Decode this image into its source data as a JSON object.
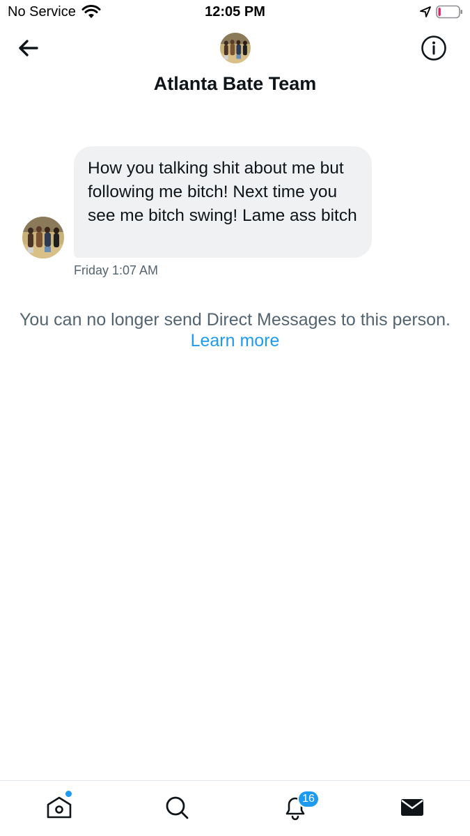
{
  "status_bar": {
    "carrier": "No Service",
    "time": "12:05 PM",
    "battery_level": 0.12
  },
  "header": {
    "title": "Atlanta Bate Team"
  },
  "messages": [
    {
      "text": "How you talking shit about me but following me bitch! Next time you see me bitch swing! Lame ass bitch",
      "timestamp": "Friday 1:07 AM"
    }
  ],
  "notice": {
    "text": "You can no longer send Direct Messages to this person.",
    "link": "Learn more"
  },
  "tab_bar": {
    "notifications_badge": "16",
    "active_tab": "messages"
  },
  "colors": {
    "accent": "#1d9bf0",
    "bubble": "#eff1f3",
    "secondary_text": "#536471",
    "battery_low": "#e0245e"
  }
}
